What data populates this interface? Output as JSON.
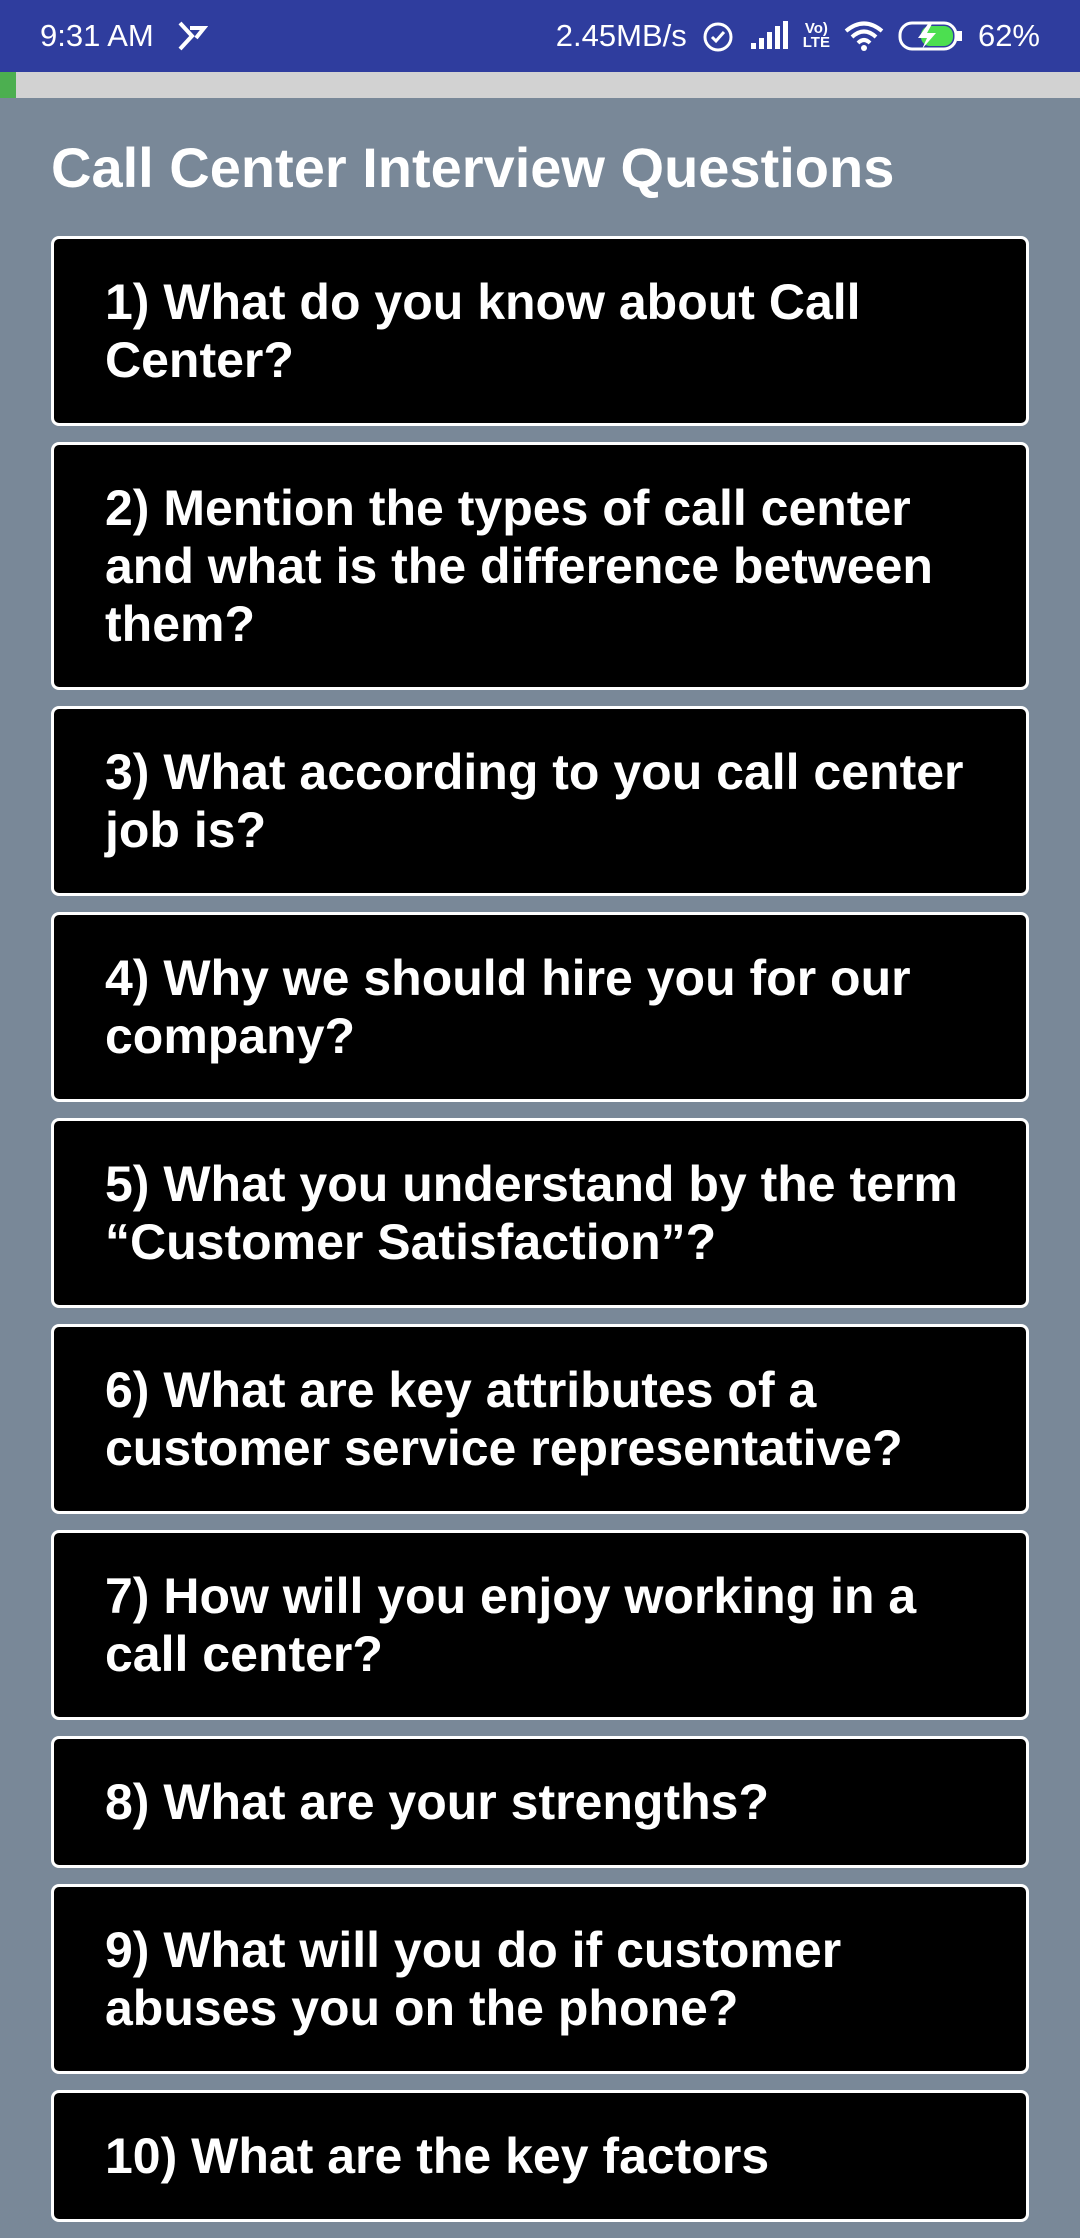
{
  "status_bar": {
    "time": "9:31 AM",
    "network_speed": "2.45MB/s",
    "volte_label_top": "Vo)",
    "volte_label_bottom": "LTE",
    "battery": "62%",
    "icons": [
      "notification-icon",
      "alarm-icon",
      "signal-icon",
      "volte-icon",
      "wifi-icon",
      "battery-charging-icon"
    ]
  },
  "progress": {
    "value": 0.015,
    "color": "#4caf50"
  },
  "page": {
    "title": "Call Center Interview Questions",
    "background": "#798898"
  },
  "questions": [
    "1) What do you know about Call Center?",
    "2) Mention the types of call center and what is the difference between them?",
    "3) What according to you call center job is?",
    "4) Why we should hire you for our company?",
    "5) What you understand by the term “Customer Satisfaction”?",
    "6) What are key attributes of a customer service representative?",
    "7) How will you enjoy working in a call center?",
    "8) What are your strengths?",
    "9) What will you do if customer abuses you on the phone?",
    "10) What are the key factors"
  ]
}
